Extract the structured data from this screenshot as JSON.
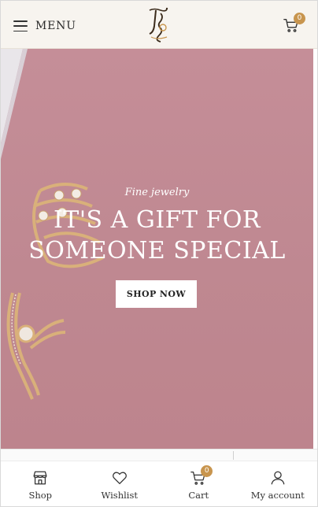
{
  "header": {
    "menu_label": "MENU",
    "cart_count": "0"
  },
  "hero": {
    "subtitle": "Fine jewelry",
    "title_line1": "IT'S A GIFT FOR",
    "title_line2": "SOMEONE SPECIAL",
    "cta_label": "SHOP NOW",
    "background_color": "#c18a93"
  },
  "bottom_nav": {
    "items": [
      {
        "label": "Shop",
        "icon": "store-icon"
      },
      {
        "label": "Wishlist",
        "icon": "heart-icon"
      },
      {
        "label": "Cart",
        "icon": "cart-icon",
        "badge": "0"
      },
      {
        "label": "My account",
        "icon": "user-icon"
      }
    ]
  },
  "colors": {
    "accent": "#c8954e",
    "header_bg": "#f7f4ef"
  }
}
